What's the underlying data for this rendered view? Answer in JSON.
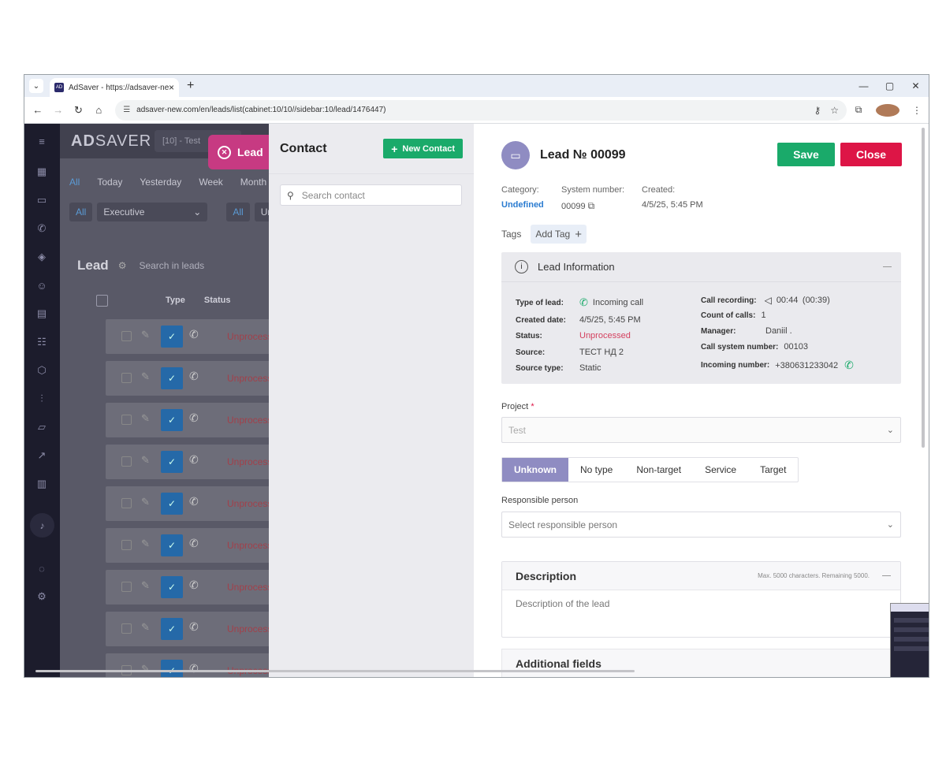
{
  "browser": {
    "tab_title": "AdSaver - https://adsaver-new...",
    "url": "adsaver-new.com/en/leads/list(cabinet:10/10//sidebar:10/lead/1476447)"
  },
  "app": {
    "logo_a": "AD",
    "logo_b": "SAVER",
    "cabinet": "[10] - Test",
    "lead_tab": "Lead",
    "filters": [
      "All",
      "Today",
      "Yesterday",
      "Week",
      "Month"
    ],
    "filter2_all": "All",
    "filter2_role": "Executive",
    "filter2_all2": "All",
    "filter2_partial": "Ur",
    "list_title": "Lead",
    "list_search": "Search in leads",
    "col_type": "Type",
    "col_status": "Status",
    "rows": [
      {
        "status": "Unprocessed"
      },
      {
        "status": "Unprocessed"
      },
      {
        "status": "Unprocessed"
      },
      {
        "status": "Unprocessed"
      },
      {
        "status": "Unprocessed"
      },
      {
        "status": "Unprocessed"
      },
      {
        "status": "Unprocessed"
      },
      {
        "status": "Unprocessed"
      },
      {
        "status": "Unprocessed"
      }
    ]
  },
  "contact": {
    "title": "Contact",
    "new_button": "New Contact",
    "search_placeholder": "Search contact"
  },
  "lead": {
    "title": "Lead № 00099",
    "save": "Save",
    "close": "Close",
    "category_label": "Category:",
    "category_value": "Undefined",
    "sysnum_label": "System number:",
    "sysnum_value": "00099",
    "created_label": "Created:",
    "created_value": "4/5/25, 5:45 PM",
    "tags_label": "Tags",
    "add_tag": "Add Tag",
    "info": {
      "title": "Lead Information",
      "type_label": "Type of lead:",
      "type_value": "Incoming call",
      "created_label": "Created date:",
      "created_value": "4/5/25, 5:45 PM",
      "status_label": "Status:",
      "status_value": "Unprocessed",
      "source_label": "Source:",
      "source_value": "ТЕСТ НД 2",
      "source_type_label": "Source type:",
      "source_type_value": "Static",
      "rec_label": "Call recording:",
      "rec_value": "00:44",
      "rec_paren": "(00:39)",
      "count_label": "Count of calls:",
      "count_value": "1",
      "manager_label": "Manager:",
      "manager_value": "Daniil .",
      "callsys_label": "Call system number:",
      "callsys_value": "00103",
      "incoming_label": "Incoming number:",
      "incoming_value": "+380631233042"
    },
    "project_label": "Project",
    "project_value": "Test",
    "types": [
      "Unknown",
      "No type",
      "Non-target",
      "Service",
      "Target"
    ],
    "responsible_label": "Responsible person",
    "responsible_placeholder": "Select responsible person",
    "description_title": "Description",
    "description_limit": "Max. 5000 characters. Remaining 5000.",
    "description_placeholder": "Description of the lead",
    "additional_fields": "Additional fields"
  },
  "colors": {
    "accent_purple": "#8f8cc2",
    "save_green": "#1aaa6a",
    "close_red": "#dd1546",
    "lead_tab_pink": "#c73a82"
  }
}
